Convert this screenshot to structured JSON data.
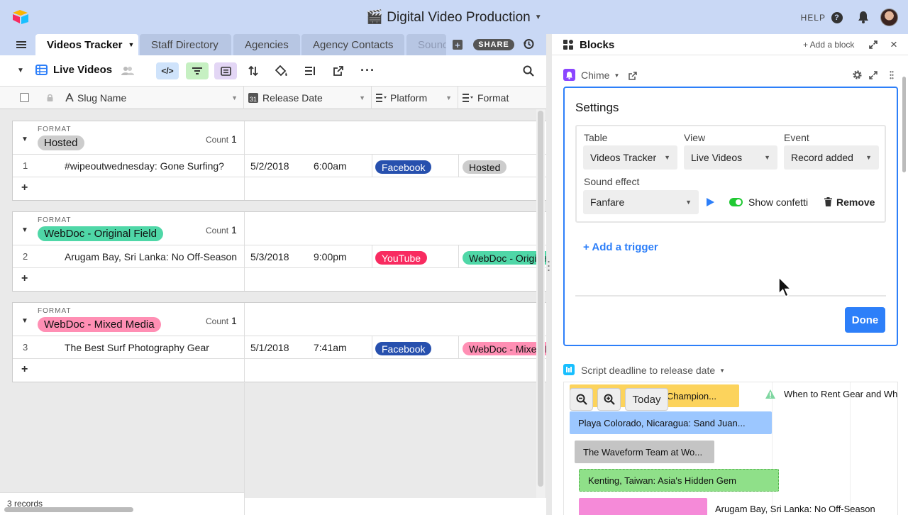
{
  "app": {
    "title": "🎬 Digital Video Production",
    "help_label": "HELP",
    "help_glyph": "?"
  },
  "tabs": {
    "items": [
      {
        "label": "Videos Tracker",
        "active": true
      },
      {
        "label": "Staff Directory",
        "active": false
      },
      {
        "label": "Agencies",
        "active": false
      },
      {
        "label": "Agency Contacts",
        "active": false
      },
      {
        "label": "Sound",
        "active": false
      }
    ],
    "share_label": "SHARE",
    "add_glyph": "+"
  },
  "toolbar": {
    "view_name": "Live Videos"
  },
  "columns": [
    {
      "label": "Slug Name"
    },
    {
      "label": "Release Date"
    },
    {
      "label": "Platform"
    },
    {
      "label": "Format"
    }
  ],
  "groups": [
    {
      "field_label": "FORMAT",
      "value": "Hosted",
      "count_label": "Count",
      "count": "1",
      "add_glyph": "+",
      "row": {
        "num": "1",
        "slug": "#wipeoutwednesday: Gone Surfing?",
        "date": "5/2/2018",
        "time": "6:00am",
        "platform": "Facebook",
        "format": "Hosted"
      }
    },
    {
      "field_label": "FORMAT",
      "value": "WebDoc - Original Field",
      "count_label": "Count",
      "count": "1",
      "add_glyph": "+",
      "row": {
        "num": "2",
        "slug": "Arugam Bay, Sri Lanka: No Off-Season",
        "date": "5/3/2018",
        "time": "9:00pm",
        "platform": "YouTube",
        "format": "WebDoc - Original Field"
      }
    },
    {
      "field_label": "FORMAT",
      "value": "WebDoc - Mixed Media",
      "count_label": "Count",
      "count": "1",
      "add_glyph": "+",
      "row": {
        "num": "3",
        "slug": "The Best Surf Photography Gear",
        "date": "5/1/2018",
        "time": "7:41am",
        "platform": "Facebook",
        "format": "WebDoc - Mixed Media"
      }
    }
  ],
  "footer": {
    "records": "3 records"
  },
  "panel": {
    "title": "Blocks",
    "add_block": "+ Add a block",
    "chime": {
      "name": "Chime",
      "settings_title": "Settings",
      "table_label": "Table",
      "table_value": "Videos Tracker",
      "view_label": "View",
      "view_value": "Live Videos",
      "event_label": "Event",
      "event_value": "Record added",
      "sound_label": "Sound effect",
      "sound_value": "Fanfare",
      "confetti_label": "Show confetti",
      "remove_label": "Remove",
      "add_trigger": "+ Add a trigger",
      "done_label": "Done"
    },
    "timeline": {
      "name": "Script deadline to release date",
      "today_label": "Today",
      "warning_text": "When to Rent Gear and When",
      "bars": [
        {
          "label": "Champion...",
          "color": "#fcd35c"
        },
        {
          "label": "Playa Colorado, Nicaragua: Sand Juan...",
          "color": "#9cc7ff"
        },
        {
          "label": "The Waveform Team at Wo...",
          "color": "#c4c4c4"
        },
        {
          "label": "Kenting, Taiwan: Asia's Hidden Gem",
          "color": "#8fe089"
        },
        {
          "label": "Arugam Bay, Sri Lanka: No Off-Season",
          "color": "#f58ad8"
        }
      ]
    }
  },
  "colors": {
    "accent": "#2d7ff9",
    "facebook": "#2750ae",
    "youtube": "#f82b60",
    "hosted": "#cccccc",
    "webdoc_original": "#4fd7a7",
    "webdoc_mixed": "#ff8fb4"
  }
}
